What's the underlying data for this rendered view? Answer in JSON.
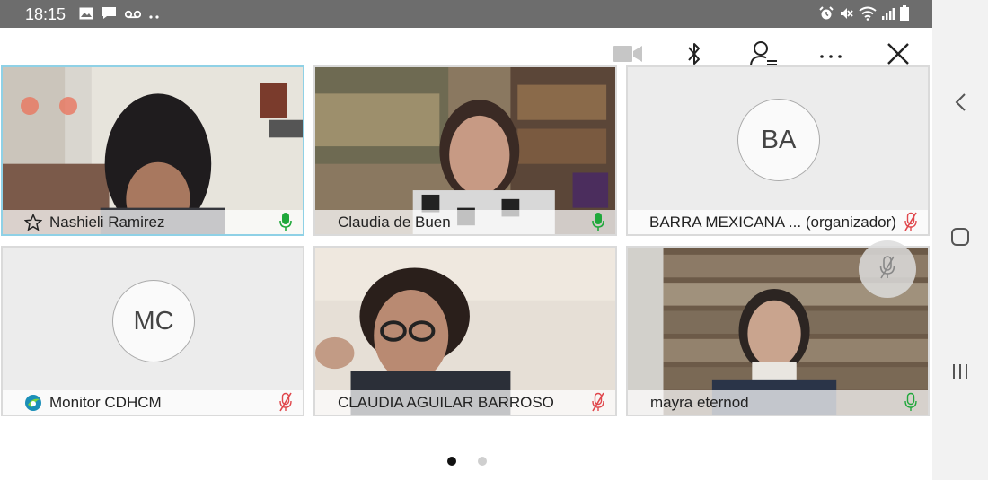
{
  "status_bar": {
    "time": "18:15",
    "icons_left": [
      "image-icon",
      "message-icon",
      "voicemail-icon",
      "more-notifications-icon"
    ],
    "icons_right": [
      "alarm-icon",
      "mute-icon",
      "wifi-icon",
      "signal-icon",
      "battery-icon"
    ]
  },
  "toolbar": {
    "buttons": [
      "video-camera-icon",
      "bluetooth-icon",
      "participants-icon",
      "more-icon",
      "close-icon"
    ]
  },
  "participants": [
    {
      "name": "Nashieli Ramirez",
      "type": "video",
      "mic": "on",
      "active": true,
      "role_icon": "star-icon"
    },
    {
      "name": "Claudia de Buen",
      "type": "video",
      "mic": "on",
      "active": false
    },
    {
      "name": "BARRA MEXICANA ... (organizador)",
      "type": "avatar",
      "initials": "BA",
      "mic": "muted",
      "active": false
    },
    {
      "name": "Monitor CDHCM",
      "type": "avatar",
      "initials": "MC",
      "mic": "muted",
      "active": false,
      "role_icon": "app-logo-icon"
    },
    {
      "name": "CLAUDIA AGUILAR BARROSO",
      "type": "video",
      "mic": "muted",
      "active": false
    },
    {
      "name": "mayra eternod",
      "type": "video",
      "mic": "on",
      "active": false
    }
  ],
  "pager": {
    "pages": 2,
    "current": 1
  },
  "colors": {
    "mic_on": "#1fa83b",
    "mic_muted": "#e0474c",
    "active_border": "#8fd1e6",
    "status_bar": "#6d6d6d"
  }
}
